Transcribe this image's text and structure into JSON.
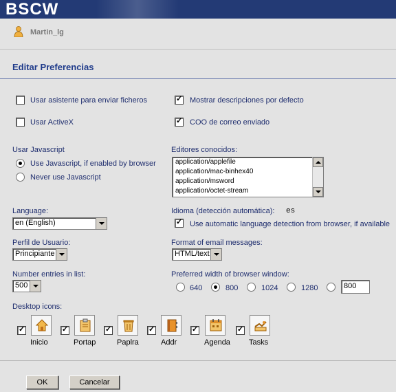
{
  "header": {
    "logo": "BSCW"
  },
  "user": {
    "name": "Martin_lg"
  },
  "page": {
    "title": "Editar Preferencias"
  },
  "options": {
    "upload_assistant": {
      "label": "Usar asistente para enviar ficheros",
      "checked": false
    },
    "activex": {
      "label": "Usar ActiveX",
      "checked": false
    },
    "show_descriptions": {
      "label": "Mostrar descripciones por defecto",
      "checked": true
    },
    "coo_email": {
      "label": "COO de correo enviado",
      "checked": true
    }
  },
  "javascript": {
    "label": "Usar Javascript",
    "options": [
      {
        "label": "Use Javascript, if enabled by browser",
        "selected": true
      },
      {
        "label": "Never use Javascript",
        "selected": false
      }
    ]
  },
  "editors": {
    "label": "Editores conocidos:",
    "items": [
      "application/applefile",
      "application/mac-binhex40",
      "application/msword",
      "application/octet-stream"
    ]
  },
  "language": {
    "label": "Language:",
    "value": "en (English)"
  },
  "idioma": {
    "label": "Idioma (detección automática):",
    "value": "es",
    "auto_label": "Use automatic language detection from browser, if available",
    "auto_checked": true
  },
  "profile": {
    "label": "Perfil de Usuario:",
    "value": "Principiante"
  },
  "email_format": {
    "label": "Format of email messages:",
    "value": "HTML/text"
  },
  "entries": {
    "label": "Number entries in list:",
    "value": "500"
  },
  "browser_width": {
    "label": "Preferred width of browser window:",
    "options": [
      "640",
      "800",
      "1024",
      "1280"
    ],
    "selected": "800",
    "custom_value": "800"
  },
  "desktop_icons": {
    "label": "Desktop icons:",
    "items": [
      {
        "label": "Inicio",
        "icon": "home-icon",
        "checked": true
      },
      {
        "label": "Portap",
        "icon": "clipboard-icon",
        "checked": true
      },
      {
        "label": "Paplra",
        "icon": "trash-icon",
        "checked": true
      },
      {
        "label": "Addr",
        "icon": "address-book-icon",
        "checked": true
      },
      {
        "label": "Agenda",
        "icon": "calendar-icon",
        "checked": true
      },
      {
        "label": "Tasks",
        "icon": "tasks-icon",
        "checked": true
      }
    ]
  },
  "buttons": {
    "ok": "OK",
    "cancel": "Cancelar"
  }
}
